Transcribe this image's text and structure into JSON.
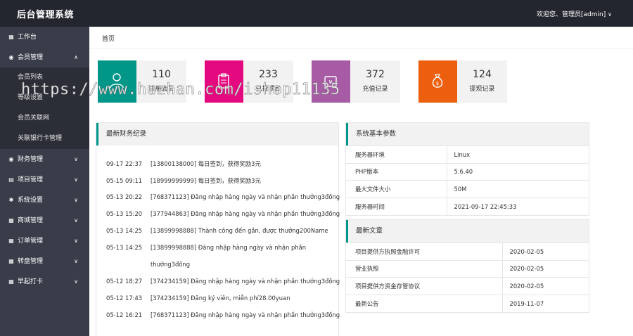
{
  "header": {
    "title": "后台管理系统",
    "welcome": "欢迎您、管理员[admin]",
    "dropdown_icon": "chevron-down-icon"
  },
  "sidebar": {
    "workbench": "工作台",
    "member": "会员管理",
    "member_children": [
      "会员列表",
      "等级设置",
      "会员关联网",
      "关联银行卡管理"
    ],
    "items": [
      "财务管理",
      "项目管理",
      "系统设置",
      "商城管理",
      "订单管理",
      "转盘管理",
      "早起打卡"
    ]
  },
  "breadcrumb": "首页",
  "stats": [
    {
      "value": "110",
      "label": "注册会员",
      "color": "#009688",
      "icon": "user-icon"
    },
    {
      "value": "233",
      "label": "已投项目",
      "color": "#e4097f",
      "icon": "clipboard-icon"
    },
    {
      "value": "372",
      "label": "充值记录",
      "color": "#a65ba4",
      "icon": "wallet-icon"
    },
    {
      "value": "124",
      "label": "提现记录",
      "color": "#ec5f0f",
      "icon": "money-bag-icon"
    }
  ],
  "finance": {
    "title": "最新财务纪录",
    "rows": [
      {
        "time": "09-17 22:37",
        "text": "[13800138000] 每日签到，获得奖励3元"
      },
      {
        "time": "05-15 09:11",
        "text": "[18999999999] 每日签到，获得奖励3元"
      },
      {
        "time": "05-13 20:22",
        "text": "[768371123] Đăng nhập hàng ngày và nhận phần thưởng3đồng"
      },
      {
        "time": "05-13 15:20",
        "text": "[377944863] Đăng nhập hàng ngày và nhận phần thưởng3đồng"
      },
      {
        "time": "05-13 14:25",
        "text": "[13899998888] Thành công đến gần, được thưởng200Name"
      },
      {
        "time": "05-13 14:25",
        "text": "[13899998888] Đăng nhập hàng ngày và nhận phần",
        "text2": "thưởng3đồng"
      },
      {
        "time": "05-12 18:27",
        "text": "[374234159] Đăng nhập hàng ngày và nhận phần thưởng3đồng"
      },
      {
        "time": "05-12 17:43",
        "text": "[374234159] Đăng ký viên, miễn phí28.00yuan"
      },
      {
        "time": "05-12 16:21",
        "text": "[768371123] Đăng nhập hàng ngày và nhận phần thưởng3đồng"
      }
    ]
  },
  "sysinfo": {
    "title": "系统基本参数",
    "rows": [
      {
        "k": "服务器环境",
        "v": "Linux"
      },
      {
        "k": "PHP版本",
        "v": "5.6.40"
      },
      {
        "k": "最大文件大小",
        "v": "50M"
      },
      {
        "k": "服务器时间",
        "v": "2021-09-17 22:45:33"
      }
    ]
  },
  "articles": {
    "title": "最新文章",
    "rows": [
      {
        "k": "项目提供方执照金融许可",
        "v": "2020-02-05"
      },
      {
        "k": "营业执照",
        "v": "2020-02-05"
      },
      {
        "k": "项目提供方资金存管协议",
        "v": "2020-02-05"
      },
      {
        "k": "最新公告",
        "v": "2019-11-07"
      }
    ]
  },
  "watermark": "https://www.huzhan.com/ishop11135"
}
